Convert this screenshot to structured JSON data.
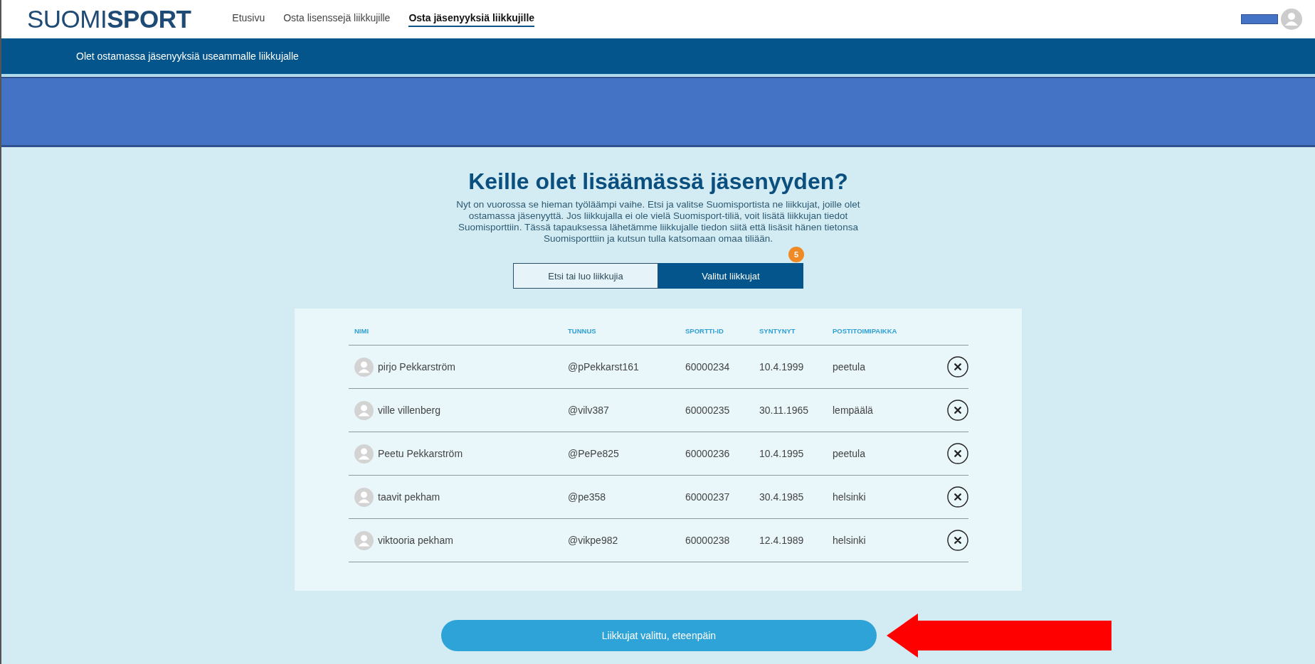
{
  "header": {
    "logo": "SUOMI**SPORT**",
    "nav": [
      {
        "label": "Etusivu",
        "selected": false
      },
      {
        "label": "Osta lisenssejä liikkujille",
        "selected": false
      },
      {
        "label": "Osta jäsenyyksiä liikkujille",
        "selected": true
      }
    ]
  },
  "subheader": "Olet ostamassa jäsenyyksiä useammalle liikkujalle",
  "heading": "Keille olet lisäämässä jäsenyyden?",
  "intro": "Nyt on vuorossa se hieman työläämpi vaihe. Etsi ja valitse Suomisportista ne liikkujat, joille olet ostamassa jäsenyyttä. Jos liikkujalla ei ole vielä Suomisport-tiliä, voit lisätä liikkujan tiedot Suomisporttiin. Tässä tapauksessa lähetämme liikkujalle tiedon siitä että lisäsit hänen tietonsa Suomisporttiin ja kutsun tulla katsomaan omaa tiliään.",
  "tabs": [
    {
      "label": "Etsi tai luo liikkujia",
      "selected": false
    },
    {
      "label": "Valitut liikkujat",
      "selected": true,
      "badge": "5"
    }
  ],
  "table": {
    "columns": [
      "NIMI",
      "TUNNUS",
      "SPORTTI-ID",
      "SYNTYNYT",
      "POSTITOIMIPAIKKA"
    ],
    "rows": [
      {
        "name": "pirjo Pekkarström",
        "handle": "@pPekkarst161",
        "id": "60000234",
        "born": "10.4.1999",
        "city": "peetula"
      },
      {
        "name": "ville villenberg",
        "handle": "@vilv387",
        "id": "60000235",
        "born": "30.11.1965",
        "city": "lempäälä"
      },
      {
        "name": "Peetu Pekkarström",
        "handle": "@PePe825",
        "id": "60000236",
        "born": "10.4.1995",
        "city": "peetula"
      },
      {
        "name": "taavit pekham",
        "handle": "@pe358",
        "id": "60000237",
        "born": "30.4.1985",
        "city": "helsinki"
      },
      {
        "name": "viktooria pekham",
        "handle": "@vikpe982",
        "id": "60000238",
        "born": "12.4.1989",
        "city": "helsinki"
      }
    ]
  },
  "next_button": "Liikkujat valittu, eteenpäin"
}
